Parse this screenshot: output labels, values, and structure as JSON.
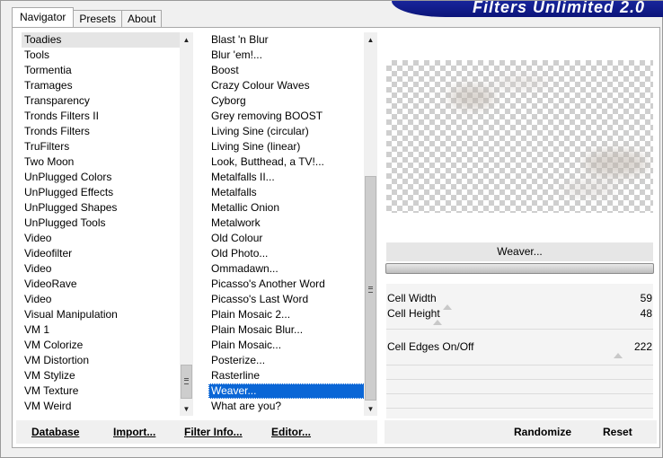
{
  "tabs": [
    {
      "label": "Navigator"
    },
    {
      "label": "Presets"
    },
    {
      "label": "About"
    }
  ],
  "banner": {
    "title": "Filters Unlimited 2.0"
  },
  "categories": {
    "items": [
      "Toadies",
      "Tools",
      "Tormentia",
      "Tramages",
      "Transparency",
      "Tronds Filters II",
      "Tronds Filters",
      "TruFilters",
      "Two Moon",
      "UnPlugged Colors",
      "UnPlugged Effects",
      "UnPlugged Shapes",
      "UnPlugged Tools",
      "Video",
      "Videofilter",
      "Video",
      "VideoRave",
      "Video",
      "Visual Manipulation",
      "VM 1",
      "VM Colorize",
      "VM Distortion",
      "VM Stylize",
      "VM Texture",
      "VM Weird"
    ],
    "selected": "Toadies"
  },
  "filters": {
    "items": [
      "Blast 'n Blur",
      "Blur 'em!...",
      "Boost",
      "Crazy Colour Waves",
      "Cyborg",
      "Grey removing BOOST",
      "Living Sine (circular)",
      "Living Sine (linear)",
      "Look, Butthead, a TV!...",
      "Metalfalls II...",
      "Metalfalls",
      "Metallic Onion",
      "Metalwork",
      "Old Colour",
      "Old Photo...",
      "Ommadawn...",
      "Picasso's Another Word",
      "Picasso's Last Word",
      "Plain Mosaic 2...",
      "Plain Mosaic Blur...",
      "Plain Mosaic...",
      "Posterize...",
      "Rasterline",
      "Weaver...",
      "What are you?"
    ],
    "selected": "Weaver..."
  },
  "buttons": {
    "database": "Database",
    "import": "Import...",
    "filter_info": "Filter Info...",
    "editor": "Editor...",
    "randomize": "Randomize",
    "reset": "Reset"
  },
  "current_filter": "Weaver...",
  "params": [
    {
      "label": "Cell Width",
      "value": "59"
    },
    {
      "label": "Cell Height",
      "value": "48"
    },
    {
      "label": "Cell Edges On/Off",
      "value": "222"
    }
  ],
  "colors": {
    "banner": "#0c157a",
    "selection": "#0a66d6"
  }
}
